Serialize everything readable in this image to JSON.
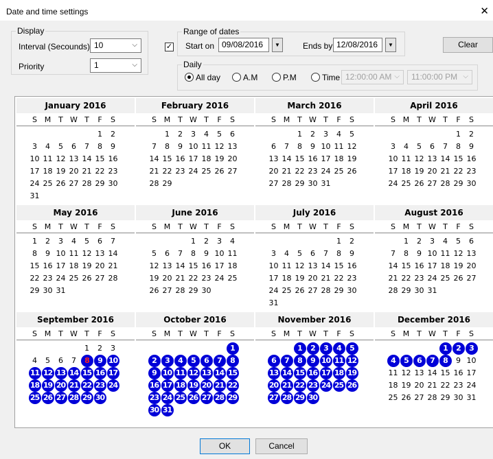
{
  "window": {
    "title": "Date and time settings",
    "close_glyph": "✕"
  },
  "display": {
    "group_label": "Display",
    "interval_label": "Interval (Secounds)",
    "interval_value": "10",
    "priority_label": "Priority",
    "priority_value": "1"
  },
  "range": {
    "enabled": true,
    "group_label": "Range of dates",
    "start_label": "Start on",
    "start_value": "09/08/2016",
    "end_label": "Ends by",
    "end_value": "12/08/2016",
    "clear_label": "Clear",
    "daily": {
      "label": "Daily",
      "options": [
        "All day",
        "A.M",
        "P.M",
        "Time"
      ],
      "selected": "All day",
      "time_from": "12:00:00 AM",
      "time_to": "11:00:00 PM"
    }
  },
  "calendar": {
    "weekday_letters": [
      "S",
      "M",
      "T",
      "W",
      "T",
      "F",
      "S"
    ],
    "today": "2016-09-08",
    "months": [
      {
        "name": "January 2016",
        "first_weekday": 5,
        "days": 31,
        "selected": []
      },
      {
        "name": "February 2016",
        "first_weekday": 1,
        "days": 29,
        "selected": []
      },
      {
        "name": "March 2016",
        "first_weekday": 2,
        "days": 31,
        "selected": []
      },
      {
        "name": "April 2016",
        "first_weekday": 5,
        "days": 30,
        "selected": []
      },
      {
        "name": "May 2016",
        "first_weekday": 0,
        "days": 31,
        "selected": []
      },
      {
        "name": "June 2016",
        "first_weekday": 3,
        "days": 30,
        "selected": []
      },
      {
        "name": "July 2016",
        "first_weekday": 5,
        "days": 31,
        "selected": []
      },
      {
        "name": "August 2016",
        "first_weekday": 1,
        "days": 31,
        "selected": []
      },
      {
        "name": "September 2016",
        "first_weekday": 4,
        "days": 30,
        "today_day": 8,
        "selected": [
          8,
          9,
          10,
          11,
          12,
          13,
          14,
          15,
          16,
          17,
          18,
          19,
          20,
          21,
          22,
          23,
          24,
          25,
          26,
          27,
          28,
          29,
          30
        ]
      },
      {
        "name": "October 2016",
        "first_weekday": 6,
        "days": 31,
        "selected": [
          1,
          2,
          3,
          4,
          5,
          6,
          7,
          8,
          9,
          10,
          11,
          12,
          13,
          14,
          15,
          16,
          17,
          18,
          19,
          20,
          21,
          22,
          23,
          24,
          25,
          26,
          27,
          28,
          29,
          30,
          31
        ]
      },
      {
        "name": "November 2016",
        "first_weekday": 2,
        "days": 30,
        "selected": [
          1,
          2,
          3,
          4,
          5,
          6,
          7,
          8,
          9,
          10,
          11,
          12,
          13,
          14,
          15,
          16,
          17,
          18,
          19,
          20,
          21,
          22,
          23,
          24,
          25,
          26,
          27,
          28,
          29,
          30
        ]
      },
      {
        "name": "December 2016",
        "first_weekday": 4,
        "days": 31,
        "selected": [
          1,
          2,
          3,
          4,
          5,
          6,
          7,
          8
        ]
      }
    ]
  },
  "footer": {
    "ok_label": "OK",
    "cancel_label": "Cancel"
  }
}
